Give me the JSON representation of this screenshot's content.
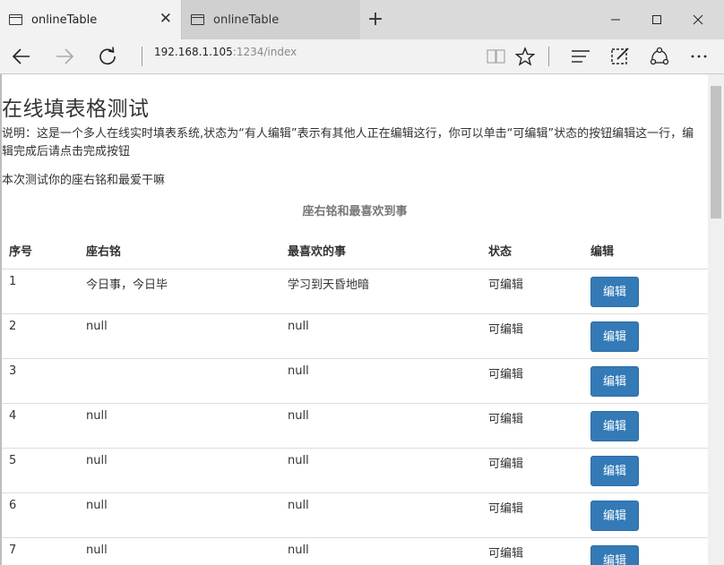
{
  "browser": {
    "tabs": [
      {
        "title": "onlineTable",
        "active": true
      },
      {
        "title": "onlineTable",
        "active": false
      }
    ],
    "address": {
      "host": "192.168.1.105",
      "path": ":1234/index"
    }
  },
  "page": {
    "heading": "在线填表格测试",
    "description": "说明：这是一个多人在线实时填表系统,状态为“有人编辑”表示有其他人正在编辑这行，你可以单击“可编辑”状态的按钮编辑这一行，编辑完成后请点击完成按钮",
    "note": "本次测试你的座右铭和最爱干嘛",
    "table": {
      "caption": "座右铭和最喜欢到事",
      "headers": [
        "序号",
        "座右铭",
        "最喜欢的事",
        "状态",
        "编辑"
      ],
      "rows": [
        {
          "id": "1",
          "motto": "今日事，今日毕",
          "favorite": "学习到天昏地暗",
          "status": "可编辑",
          "action": "编辑"
        },
        {
          "id": "2",
          "motto": "null",
          "favorite": "null",
          "status": "可编辑",
          "action": "编辑"
        },
        {
          "id": "3",
          "motto": "",
          "favorite": "null",
          "status": "可编辑",
          "action": "编辑"
        },
        {
          "id": "4",
          "motto": "null",
          "favorite": "null",
          "status": "可编辑",
          "action": "编辑"
        },
        {
          "id": "5",
          "motto": "null",
          "favorite": "null",
          "status": "可编辑",
          "action": "编辑"
        },
        {
          "id": "6",
          "motto": "null",
          "favorite": "null",
          "status": "可编辑",
          "action": "编辑"
        },
        {
          "id": "7",
          "motto": "null",
          "favorite": "null",
          "status": "可编辑",
          "action": "编辑"
        }
      ]
    }
  },
  "colors": {
    "button": "#337ab7",
    "tab_active": "#f2f2f2",
    "tabbar": "#dadada"
  },
  "icons": [
    "tab-page-icon",
    "close-icon",
    "new-tab-icon",
    "minimize-icon",
    "maximize-icon",
    "window-close-icon",
    "back-icon",
    "forward-icon",
    "refresh-icon",
    "reading-view-icon",
    "favorite-star-icon",
    "hub-icon",
    "web-note-icon",
    "share-icon",
    "more-icon"
  ]
}
